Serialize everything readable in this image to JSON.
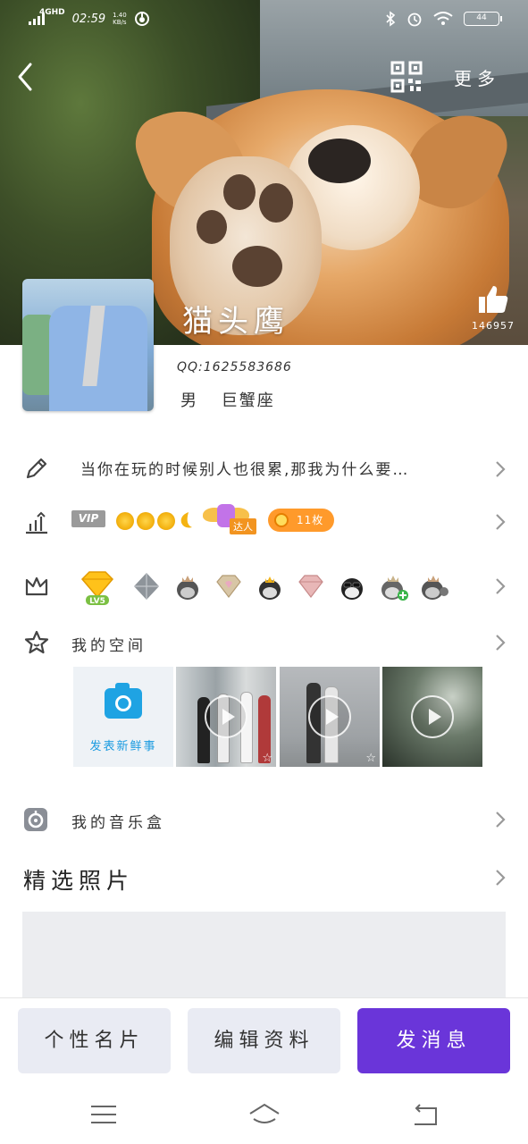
{
  "status_bar": {
    "network": "4GHD",
    "time": "02:59",
    "speed_value": "1.40",
    "speed_unit": "KB/s",
    "battery": "44"
  },
  "header": {
    "more_label": "更多",
    "nickname": "猫头鹰",
    "like_count": "146957",
    "qq": "QQ:1625583686",
    "gender": "男",
    "zodiac": "巨蟹座"
  },
  "signature": {
    "text": "当你在玩的时候别人也很累,那我为什么要…"
  },
  "vip_row": {
    "vip_label": "VIP",
    "talent_label": "达人",
    "coin_label": "11枚"
  },
  "space": {
    "title": "我的空间",
    "post_label": "发表新鲜事"
  },
  "music": {
    "title": "我的音乐盒"
  },
  "photos": {
    "title": "精选照片"
  },
  "actions": {
    "card": "个性名片",
    "edit": "编辑资料",
    "message": "发消息"
  },
  "colors": {
    "primary": "#6a35d9",
    "gray_button": "#e9ebf3",
    "coin": "#ff9a2b",
    "camera": "#1fa3e3"
  }
}
